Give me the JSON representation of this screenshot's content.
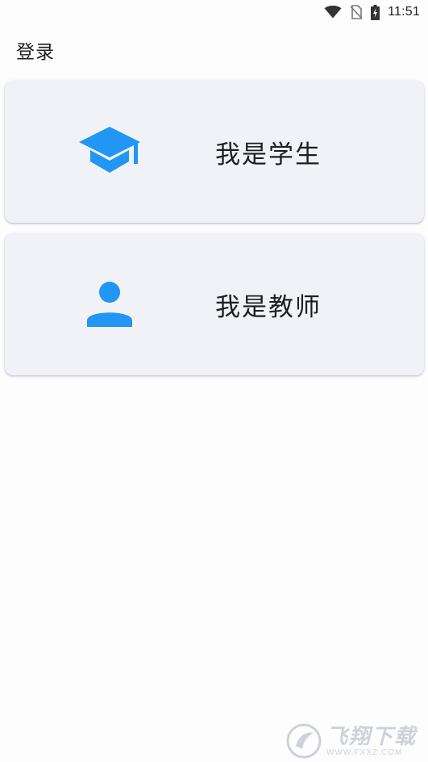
{
  "status_bar": {
    "time": "11:51",
    "icons": [
      "wifi-icon",
      "no-sim-icon",
      "battery-charging-icon"
    ]
  },
  "app_bar": {
    "title": "登录"
  },
  "roles": [
    {
      "label": "我是学生",
      "icon": "graduation-cap-icon"
    },
    {
      "label": "我是教师",
      "icon": "person-icon"
    }
  ],
  "watermark": {
    "brand": "飞翔下载",
    "url": "WWW.FXXZ.COM"
  },
  "colors": {
    "accent": "#2196f3",
    "card_background": "#f0f2f8",
    "page_background": "#fdfdfe"
  }
}
